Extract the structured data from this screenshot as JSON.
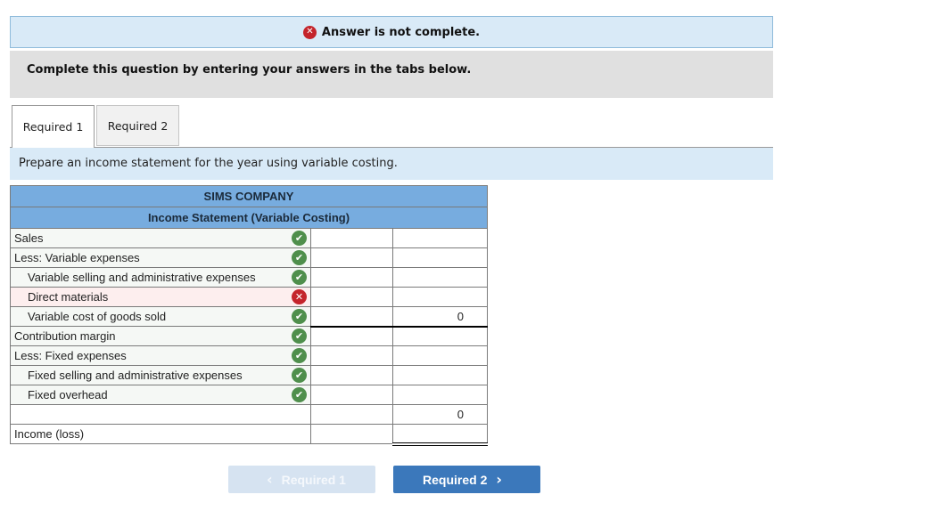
{
  "banner": {
    "icon": "x-circle-icon",
    "text": "Answer is not complete."
  },
  "instructions": "Complete this question by entering your answers in the tabs below.",
  "tabs": [
    {
      "label": "Required 1",
      "active": true
    },
    {
      "label": "Required 2",
      "active": false
    }
  ],
  "prompt": "Prepare an income statement for the year using variable costing.",
  "statement": {
    "company": "SIMS COMPANY",
    "title": "Income Statement (Variable Costing)",
    "rows": [
      {
        "label": "Sales",
        "indent": false,
        "status": "correct",
        "col1": "",
        "col2": ""
      },
      {
        "label": "Less: Variable expenses",
        "indent": false,
        "status": "correct",
        "col1": "",
        "col2": ""
      },
      {
        "label": "Variable selling and administrative expenses",
        "indent": true,
        "status": "correct",
        "col1": "",
        "col2": ""
      },
      {
        "label": "Direct materials",
        "indent": true,
        "status": "incorrect",
        "col1": "",
        "col2": ""
      },
      {
        "label": "Variable cost of goods sold",
        "indent": true,
        "status": "correct",
        "col1": "",
        "col2": "0"
      },
      {
        "label": "Contribution margin",
        "indent": false,
        "status": "correct",
        "col1": "",
        "col2": ""
      },
      {
        "label": "Less: Fixed expenses",
        "indent": false,
        "status": "correct",
        "col1": "",
        "col2": ""
      },
      {
        "label": "Fixed selling and administrative expenses",
        "indent": true,
        "status": "correct",
        "col1": "",
        "col2": ""
      },
      {
        "label": "Fixed overhead",
        "indent": true,
        "status": "correct",
        "col1": "",
        "col2": ""
      },
      {
        "label": "",
        "indent": false,
        "status": "none",
        "col1": "",
        "col2": "0"
      },
      {
        "label": "Income (loss)",
        "indent": false,
        "status": "none",
        "col1": "",
        "col2": ""
      }
    ],
    "status_icons": {
      "correct": "✔",
      "incorrect": "✕"
    }
  },
  "nav": {
    "prev_label": "Required 1",
    "next_label": "Required 2",
    "prev_icon": "‹",
    "next_icon": "›"
  },
  "colors": {
    "correct": "#4f8f4c",
    "incorrect": "#c4242b",
    "header_blue": "#77acdf",
    "next_button": "#3b78bb"
  }
}
